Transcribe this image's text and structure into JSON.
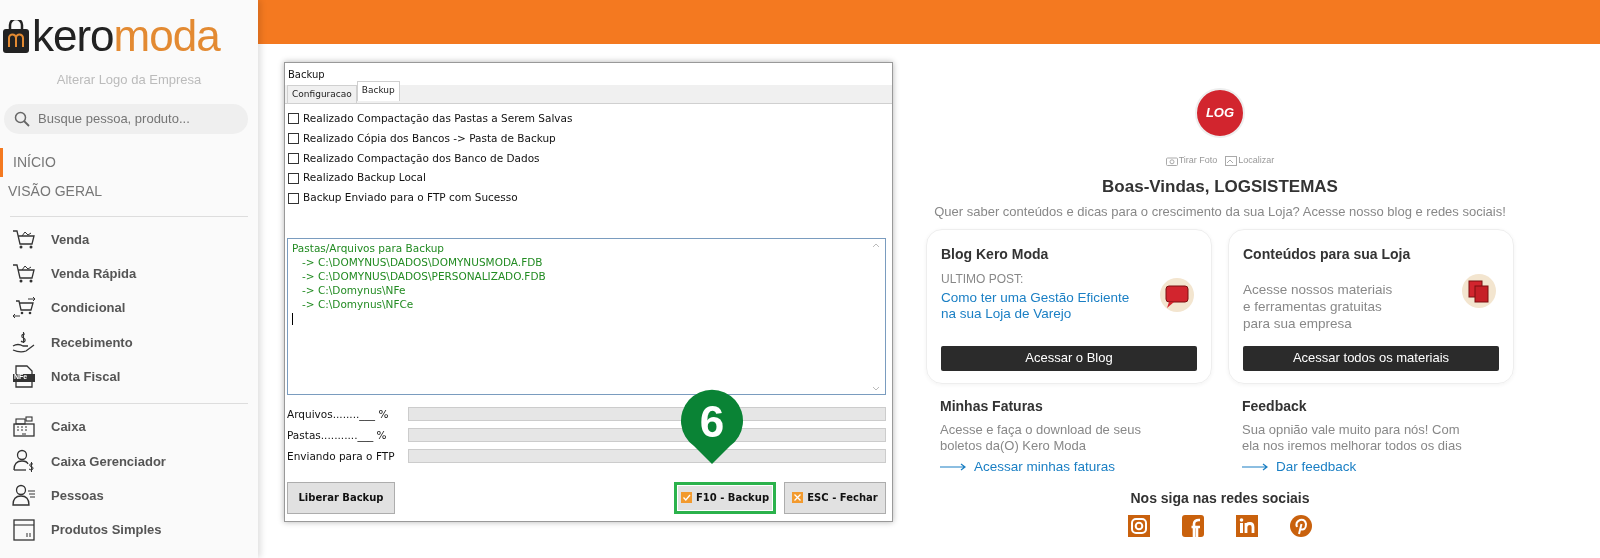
{
  "sidebar": {
    "logo": {
      "part_1": "kero",
      "part_2": "moda"
    },
    "change_logo": "Alterar Logo da Empresa",
    "search": {
      "placeholder": "Busque pessoa, produto..."
    },
    "sections": [
      {
        "label": "INÍCIO",
        "selected": true
      },
      {
        "label": "VISÃO GERAL",
        "selected": false
      }
    ],
    "groups": [
      [
        {
          "label": "Venda",
          "kind": "cart"
        },
        {
          "label": "Venda Rápida",
          "kind": "cart"
        },
        {
          "label": "Condicional",
          "kind": "exchange"
        },
        {
          "label": "Recebimento",
          "kind": "money"
        },
        {
          "label": "Nota Fiscal",
          "kind": "nfe",
          "icon_text": "NFe"
        }
      ],
      [
        {
          "label": "Caixa",
          "kind": "register"
        },
        {
          "label": "Caixa Gerenciador",
          "kind": "manager"
        },
        {
          "label": "Pessoas",
          "kind": "person"
        },
        {
          "label": "Produtos Simples",
          "kind": "box"
        }
      ]
    ]
  },
  "dialog": {
    "title": "Backup",
    "tabs": [
      {
        "label": "Configuracao",
        "selected": false
      },
      {
        "label": "Backup",
        "selected": true
      }
    ],
    "checks": [
      {
        "label": "Realizado Compactação das Pastas a Serem Salvas",
        "checked": false
      },
      {
        "label": "Realizado Cópia dos Bancos -> Pasta de Backup",
        "checked": false
      },
      {
        "label": "Realizado Compactação dos Banco de Dados",
        "checked": false
      },
      {
        "label": "Realizado Backup Local",
        "checked": false
      },
      {
        "label": "Backup Enviado para o FTP com Sucesso",
        "checked": false
      }
    ],
    "log_lines": [
      "Pastas/Arquivos para Backup",
      "   -> C:\\DOMYNUS\\DADOS\\DOMYNUSMODA.FDB",
      "   -> C:\\DOMYNUS\\DADOS\\PERSONALIZADO.FDB",
      "   -> C:\\Domynus\\NFe",
      "   -> C:\\Domynus\\NFCe"
    ],
    "progress": [
      {
        "label": "Arquivos........___ %",
        "level": 0
      },
      {
        "label": "Pastas...........___ %",
        "level": 0
      },
      {
        "label": "Enviando para o FTP",
        "level": 0
      }
    ],
    "buttons": [
      {
        "label": "Liberar Backup",
        "kind": "plain",
        "highlighted": false
      },
      {
        "label": "F10 - Backup",
        "kind": "ok",
        "highlighted": true
      },
      {
        "label": "ESC - Fechar",
        "kind": "cancel",
        "highlighted": false
      }
    ],
    "callout": "6"
  },
  "welcome": {
    "company_logo": "LOG",
    "photo_actions": [
      "Tirar Foto",
      "Localizar"
    ],
    "title": "Boas-Vindas, LOGSISTEMAS",
    "subtitle": "Quer saber conteúdos e dicas para o crescimento da sua Loja? Acesse nosso blog e redes sociais!",
    "cards": [
      {
        "title": "Blog Kero Moda",
        "kind": "blog",
        "caption": "ULTIMO POST:",
        "link": "Como ter uma Gestão Eficiente na sua Loja de Varejo",
        "button": "Acessar o Blog"
      },
      {
        "title": "Conteúdos para sua Loja",
        "kind": "materials",
        "text": "Acesse nossos materiais e ferramentas gratuitas para sua empresa",
        "button": "Acessar todos os materiais"
      }
    ],
    "sections": [
      {
        "title": "Minhas Faturas",
        "text": "Acesse e faça o download de seus boletos da(O) Kero Moda",
        "link": "Acessar minhas faturas"
      },
      {
        "title": "Feedback",
        "text": "Sua opnião vale muito para nós! Com ela nos iremos melhorar todos os dias",
        "link": "Dar feedback"
      }
    ],
    "social_title": "Nos siga nas redes sociais",
    "social": [
      {
        "kind": "instagram"
      },
      {
        "kind": "facebook"
      },
      {
        "kind": "linkedin"
      },
      {
        "kind": "pinterest"
      }
    ]
  }
}
